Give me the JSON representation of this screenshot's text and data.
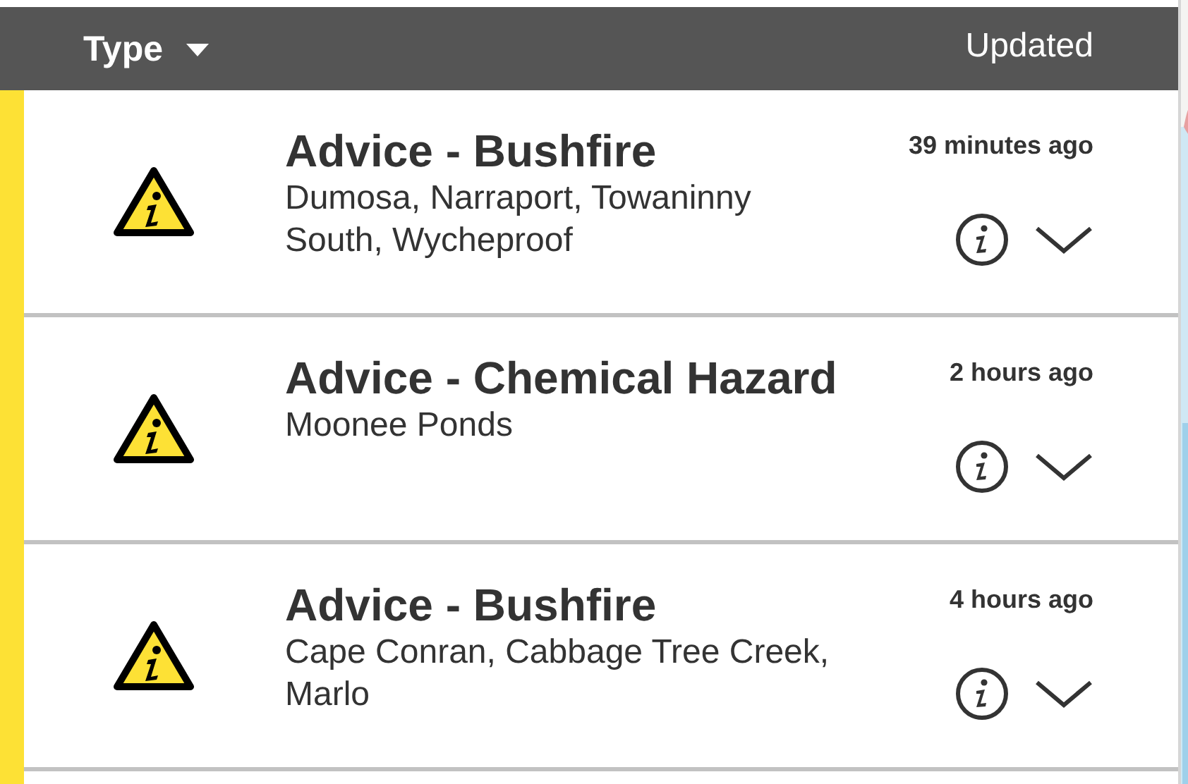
{
  "header": {
    "type_label": "Type",
    "updated_label": "Updated"
  },
  "warnings": [
    {
      "title": "Advice - Bushfire",
      "locations": "Dumosa, Narraport, Towaninny South, Wycheproof",
      "time": "39 minutes ago"
    },
    {
      "title": "Advice - Chemical Hazard",
      "locations": "Moonee Ponds",
      "time": "2 hours ago"
    },
    {
      "title": "Advice - Bushfire",
      "locations": "Cape Conran, Cabbage Tree Creek, Marlo",
      "time": "4 hours ago"
    }
  ]
}
